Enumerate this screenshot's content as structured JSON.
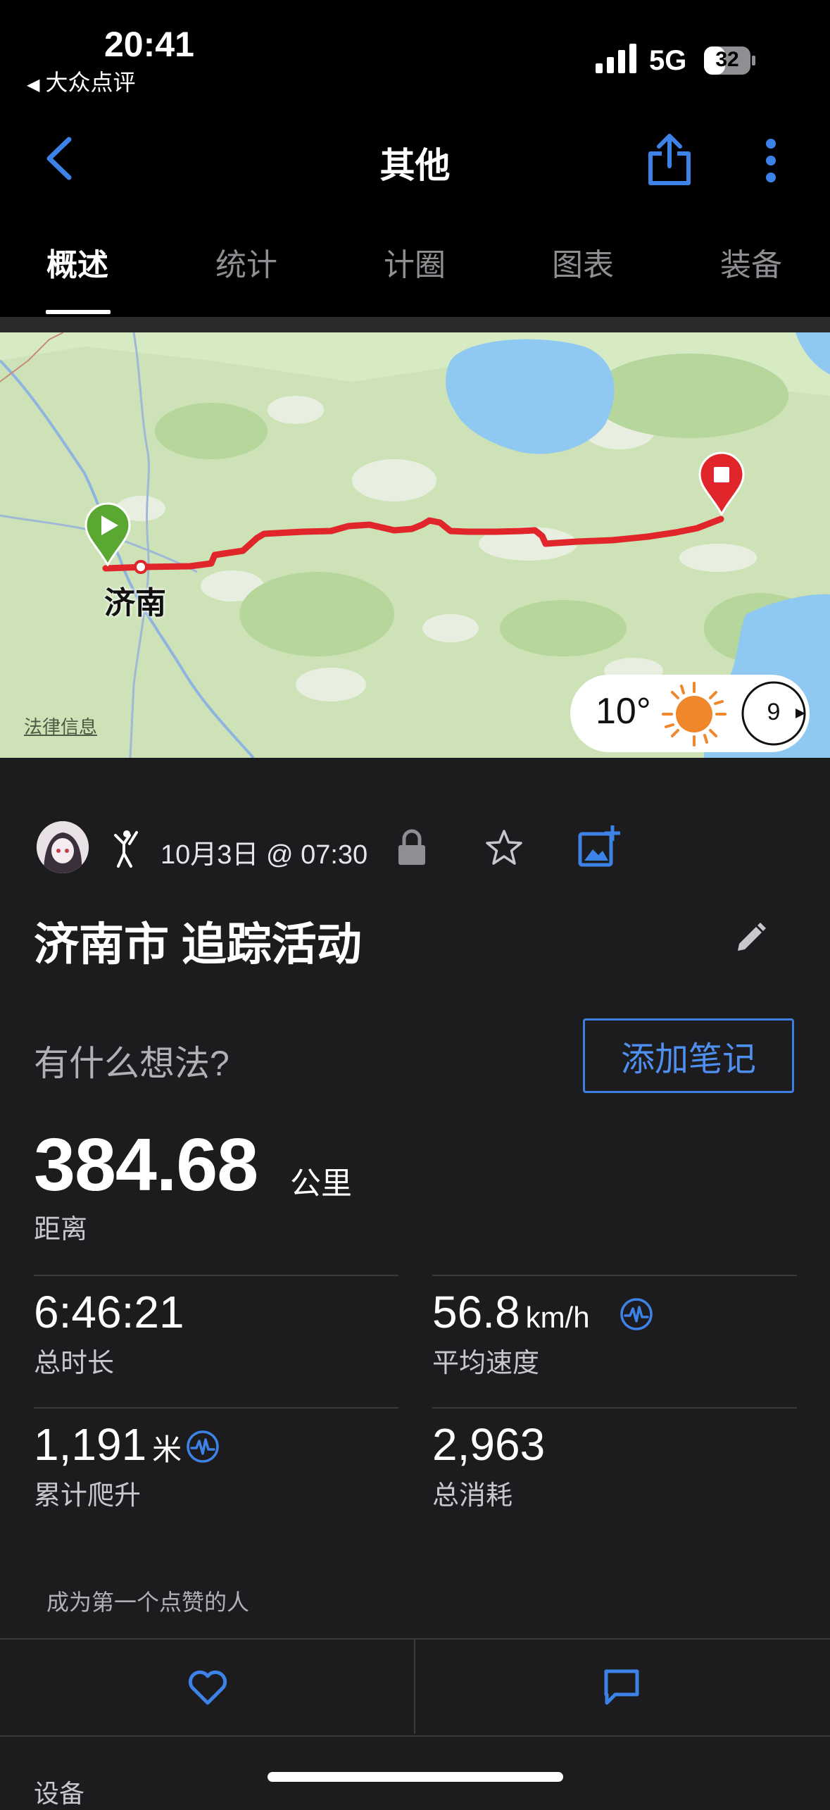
{
  "status_bar": {
    "time": "20:41",
    "back_app": "大众点评",
    "network": "5G",
    "battery": "32"
  },
  "nav": {
    "title": "其他"
  },
  "tabs": [
    {
      "label": "概述",
      "active": true
    },
    {
      "label": "统计",
      "active": false
    },
    {
      "label": "计圈",
      "active": false
    },
    {
      "label": "图表",
      "active": false
    },
    {
      "label": "装备",
      "active": false
    }
  ],
  "map": {
    "city_label": "济南",
    "legal_link": "法律信息",
    "route_color": "#e0262b",
    "start_color": "#5aa832",
    "end_color": "#e0262b",
    "weather": {
      "temperature": "10°",
      "icon": "sun-icon",
      "wind_speed": "9"
    }
  },
  "activity": {
    "date": "10月3日 @ 07:30",
    "title": "济南市 追踪活动",
    "thoughts_placeholder": "有什么想法?",
    "add_note_label": "添加笔记",
    "distance": {
      "value": "384.68",
      "unit": "公里",
      "label": "距离"
    },
    "stats": [
      {
        "value": "6:46:21",
        "unit": "",
        "label": "总时长"
      },
      {
        "value": "56.8",
        "unit": "km/h",
        "label": "平均速度"
      },
      {
        "value": "1,191",
        "unit": "米",
        "label": "累计爬升"
      },
      {
        "value": "2,963",
        "unit": "",
        "label": "总消耗"
      }
    ],
    "likes_text": "成为第一个点赞的人",
    "device_label": "设备"
  },
  "colors": {
    "accent": "#4e8ff0",
    "background": "#1c1c1e"
  }
}
